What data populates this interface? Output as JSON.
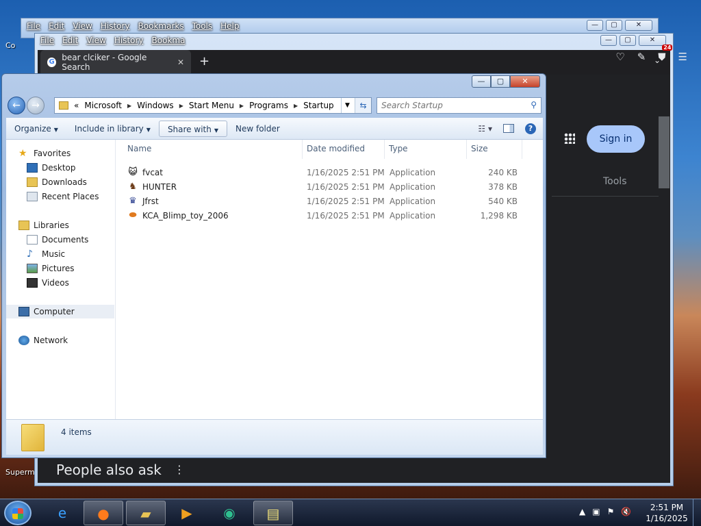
{
  "desktop": {
    "icon_top_label": "Co",
    "icon_bottom_label": "Superm"
  },
  "browser_back": {
    "menu": [
      "File",
      "Edit",
      "View",
      "History",
      "Bookmarks",
      "Tools",
      "Help"
    ]
  },
  "browser_front": {
    "menu": [
      "File",
      "Edit",
      "View",
      "History",
      "Bookma"
    ],
    "tab_title": "bear clciker - Google Search",
    "tab_close": "✕",
    "new_tab": "+",
    "tab_list": "⌄",
    "extension_badge": "24",
    "sign_in": "Sign in",
    "tools": "Tools",
    "people_also_ask": "People also ask",
    "paa_menu": "⋮"
  },
  "explorer": {
    "window_controls": [
      "—",
      "▢",
      "✕"
    ],
    "address": {
      "root_chevron": "«",
      "crumbs": [
        "Microsoft",
        "Windows",
        "Start Menu",
        "Programs",
        "Startup"
      ]
    },
    "search_placeholder": "Search Startup",
    "toolbar": {
      "organize": "Organize",
      "include_in_library": "Include in library",
      "share_with": "Share with",
      "new_folder": "New folder",
      "help": "?"
    },
    "nav": {
      "favorites": "Favorites",
      "desktop": "Desktop",
      "downloads": "Downloads",
      "recent_places": "Recent Places",
      "libraries": "Libraries",
      "documents": "Documents",
      "music": "Music",
      "pictures": "Pictures",
      "videos": "Videos",
      "computer": "Computer",
      "network": "Network"
    },
    "columns": {
      "name": "Name",
      "date_modified": "Date modified",
      "type": "Type",
      "size": "Size"
    },
    "files": [
      {
        "name": "fvcat",
        "date": "1/16/2025 2:51 PM",
        "type": "Application",
        "size": "240 KB",
        "icon": "cat-face-icon"
      },
      {
        "name": "HUNTER",
        "date": "1/16/2025 2:51 PM",
        "type": "Application",
        "size": "378 KB",
        "icon": "hunter-icon"
      },
      {
        "name": "Jfrst",
        "date": "1/16/2025 2:51 PM",
        "type": "Application",
        "size": "540 KB",
        "icon": "creature-icon"
      },
      {
        "name": "KCA_Blimp_toy_2006",
        "date": "1/16/2025 2:51 PM",
        "type": "Application",
        "size": "1,298 KB",
        "icon": "blimp-icon"
      }
    ],
    "status_count": "4 items"
  },
  "taskbar": {
    "time": "2:51 PM",
    "date": "1/16/2025"
  }
}
